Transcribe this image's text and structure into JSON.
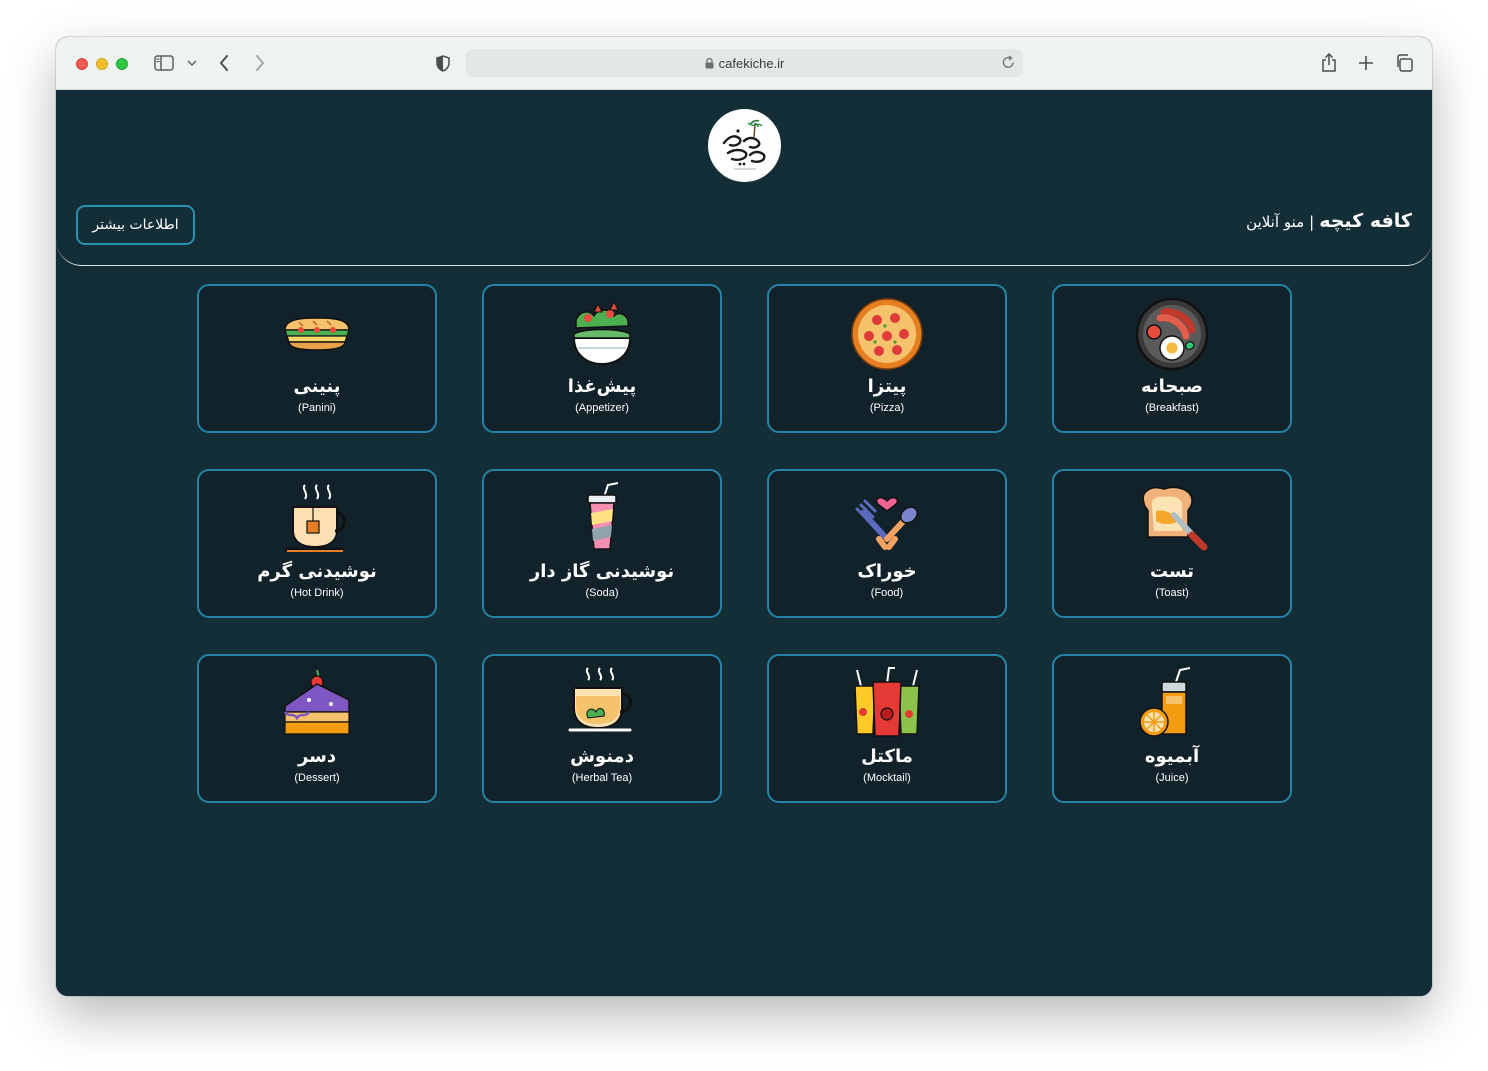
{
  "browser": {
    "url": "cafekiche.ir"
  },
  "header": {
    "brand_name": "کافه کیچه",
    "separator": "|",
    "subtitle": "منو آنلاین",
    "more_button": "اطلاعات بیشتر"
  },
  "categories": [
    {
      "fa": "صبحانه",
      "en": "(Breakfast)",
      "icon": "breakfast-icon"
    },
    {
      "fa": "پیتزا",
      "en": "(Pizza)",
      "icon": "pizza-icon"
    },
    {
      "fa": "پیش‌غذا",
      "en": "(Appetizer)",
      "icon": "salad-icon"
    },
    {
      "fa": "پنینی",
      "en": "(Panini)",
      "icon": "sandwich-icon"
    },
    {
      "fa": "تست",
      "en": "(Toast)",
      "icon": "toast-icon"
    },
    {
      "fa": "خوراک",
      "en": "(Food)",
      "icon": "food-icon"
    },
    {
      "fa": "نوشیدنی گاز دار",
      "en": "(Soda)",
      "icon": "soda-icon"
    },
    {
      "fa": "نوشیدنی گرم",
      "en": "(Hot Drink)",
      "icon": "hot-drink-icon"
    },
    {
      "fa": "آبمیوه",
      "en": "(Juice)",
      "icon": "juice-icon"
    },
    {
      "fa": "ماکتل",
      "en": "(Mocktail)",
      "icon": "mocktail-icon"
    },
    {
      "fa": "دمنوش",
      "en": "(Herbal Tea)",
      "icon": "herbal-tea-icon"
    },
    {
      "fa": "دسر",
      "en": "(Dessert)",
      "icon": "dessert-icon"
    }
  ]
}
